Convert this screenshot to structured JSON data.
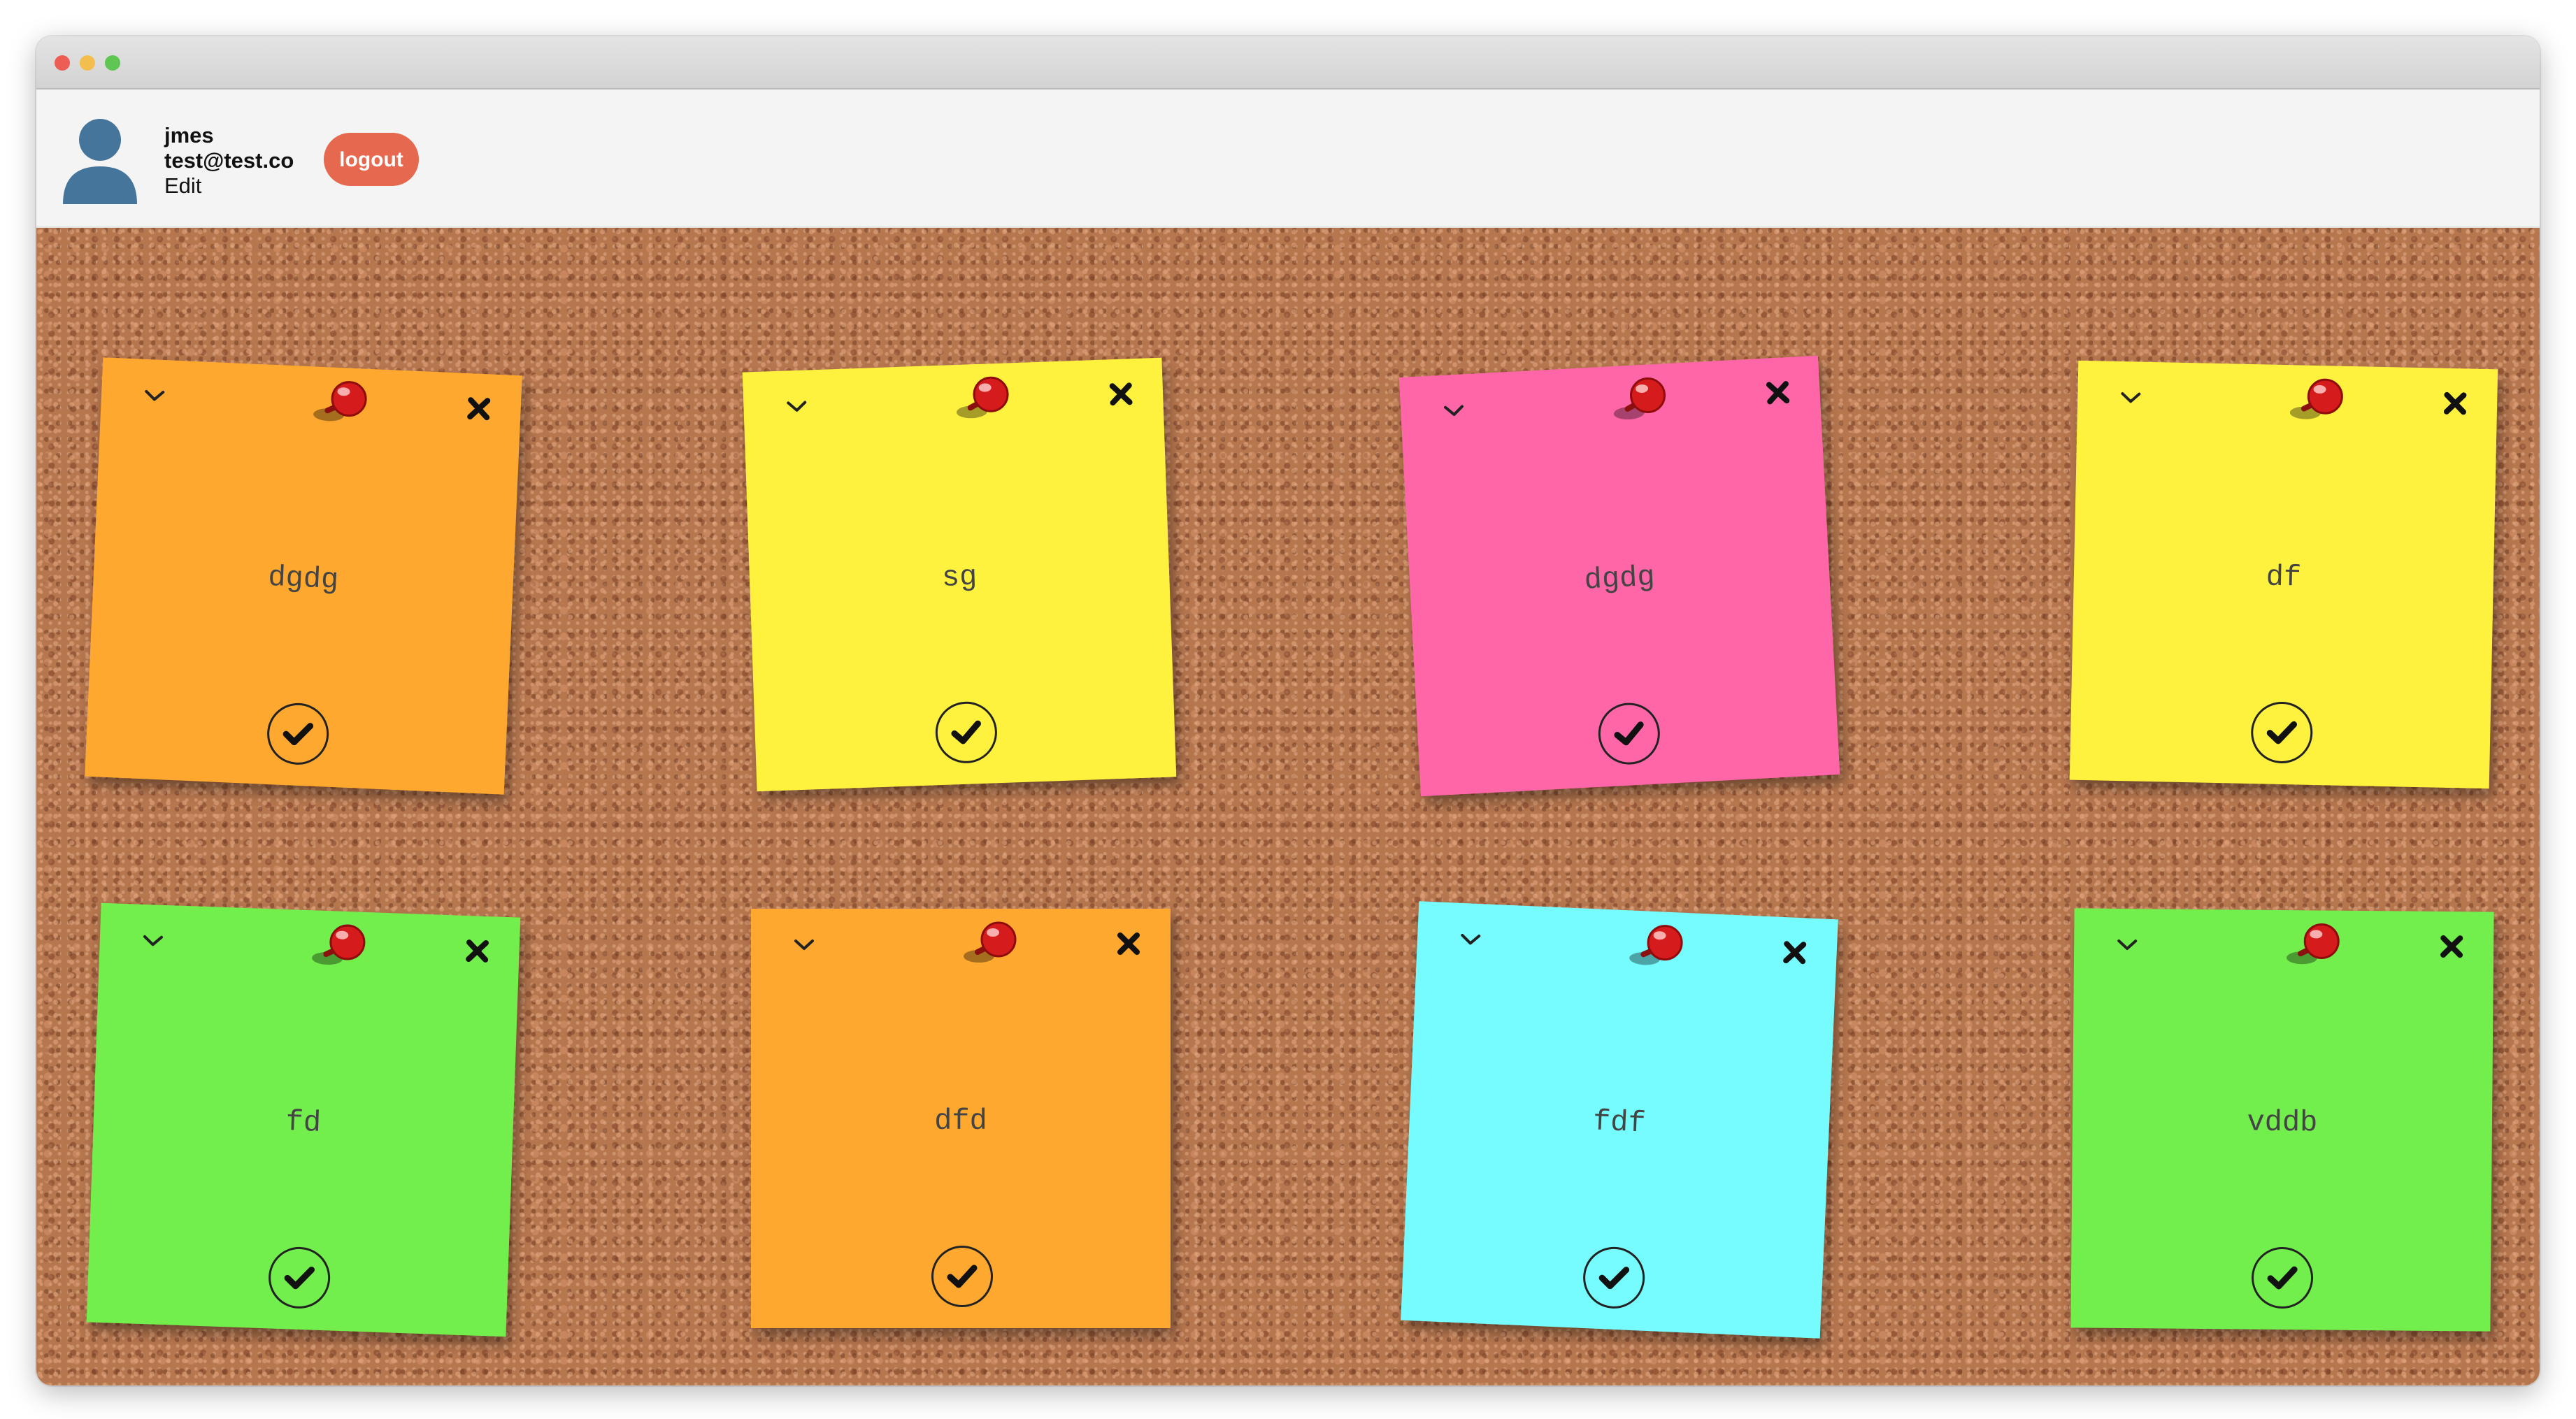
{
  "user": {
    "name": "jmes",
    "email": "test@test.co",
    "edit_label": "Edit",
    "logout_label": "logout"
  },
  "colors": {
    "orange": "#fea82f",
    "yellow": "#fff23f",
    "pink": "#ff66a8",
    "green": "#72ee4d",
    "cyan": "#76fcff",
    "logout": "#e6684e",
    "avatar": "#45759b"
  },
  "notes": [
    {
      "text": "dgdg",
      "color": "orange"
    },
    {
      "text": "sg",
      "color": "yellow"
    },
    {
      "text": "dgdg",
      "color": "pink"
    },
    {
      "text": "df",
      "color": "yellow"
    },
    {
      "text": "fd",
      "color": "green"
    },
    {
      "text": "dfd",
      "color": "orange"
    },
    {
      "text": "fdf",
      "color": "cyan"
    },
    {
      "text": "vddb",
      "color": "green"
    }
  ],
  "icons": {
    "collapse": "chevron-down-icon",
    "delete": "close-icon",
    "pin": "pushpin-icon",
    "done": "check-icon"
  }
}
